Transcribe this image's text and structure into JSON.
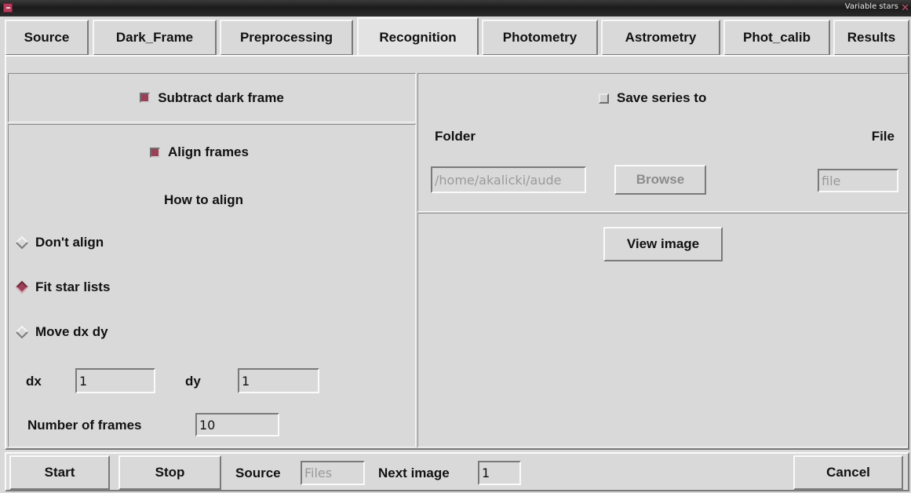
{
  "window": {
    "title": "Variable stars",
    "close_glyph": "✕"
  },
  "tabs": [
    {
      "label": "Source"
    },
    {
      "label": "Dark_Frame"
    },
    {
      "label": "Preprocessing"
    },
    {
      "label": "Recognition",
      "active": true
    },
    {
      "label": "Photometry"
    },
    {
      "label": "Astrometry"
    },
    {
      "label": "Phot_calib"
    },
    {
      "label": "Results"
    }
  ],
  "dark": {
    "label": "Subtract dark frame",
    "checked": true
  },
  "align": {
    "label": "Align frames",
    "checked": true,
    "how_label": "How to align",
    "options": [
      {
        "label": "Don't align",
        "selected": false
      },
      {
        "label": "Fit star lists",
        "selected": true
      },
      {
        "label": "Move dx dy",
        "selected": false
      }
    ],
    "dx_label": "dx",
    "dx_value": "1",
    "dy_label": "dy",
    "dy_value": "1",
    "frames_label": "Number of frames",
    "frames_value": "10"
  },
  "save": {
    "label": "Save series to",
    "checked": false,
    "folder_label": "Folder",
    "folder_value": "/home/akalicki/aude",
    "browse_label": "Browse",
    "file_label": "File",
    "file_placeholder": "file"
  },
  "view_image_label": "View image",
  "bottom": {
    "start_label": "Start",
    "stop_label": "Stop",
    "source_label": "Source",
    "source_value": "Files",
    "next_label": "Next image",
    "next_value": "1",
    "cancel_label": "Cancel"
  },
  "colors": {
    "accent": "#9a3f56",
    "background": "#d9d9d9"
  }
}
